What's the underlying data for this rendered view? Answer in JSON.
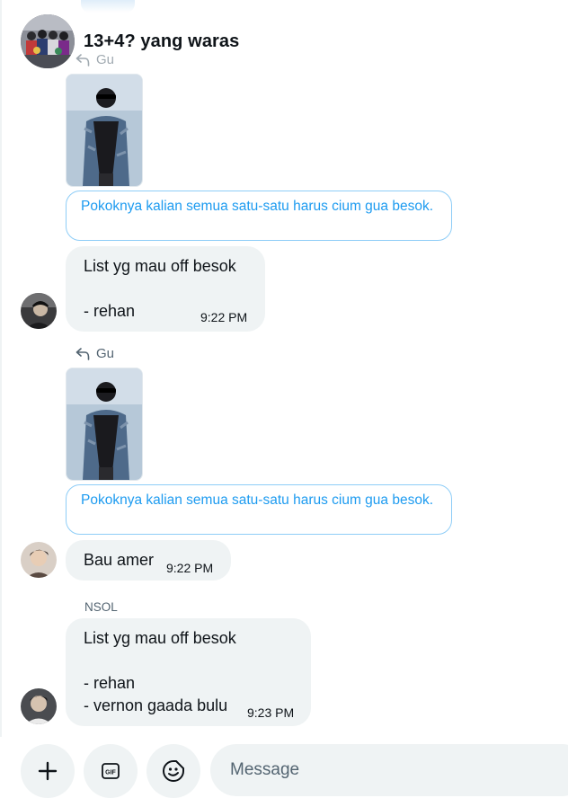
{
  "conversation": {
    "title": "13+4? yang waras"
  },
  "messages": [
    {
      "reply_to": "Gu",
      "quote": "Pokoknya kalian semua satu-satu harus cium gua besok.",
      "lines": [
        "List yg mau off besok",
        "",
        "- rehan"
      ],
      "time": "9:22 PM"
    },
    {
      "reply_to": "Gu",
      "quote": "Pokoknya kalian semua satu-satu harus cium gua besok.",
      "lines": [
        "Bau amer"
      ],
      "time": "9:22 PM"
    },
    {
      "sender": "NSOL",
      "lines": [
        "List yg mau off besok",
        "",
        "- rehan",
        "- vernon gaada bulu"
      ],
      "time": "9:23 PM"
    }
  ],
  "composer": {
    "placeholder": "Message"
  },
  "icons": [
    "plus-icon",
    "gif-icon",
    "emoji-icon",
    "reply-icon"
  ],
  "colors": {
    "accent": "#1d9bf0",
    "bubble": "#eff3f4",
    "text": "#0f1419",
    "muted": "#536471"
  }
}
